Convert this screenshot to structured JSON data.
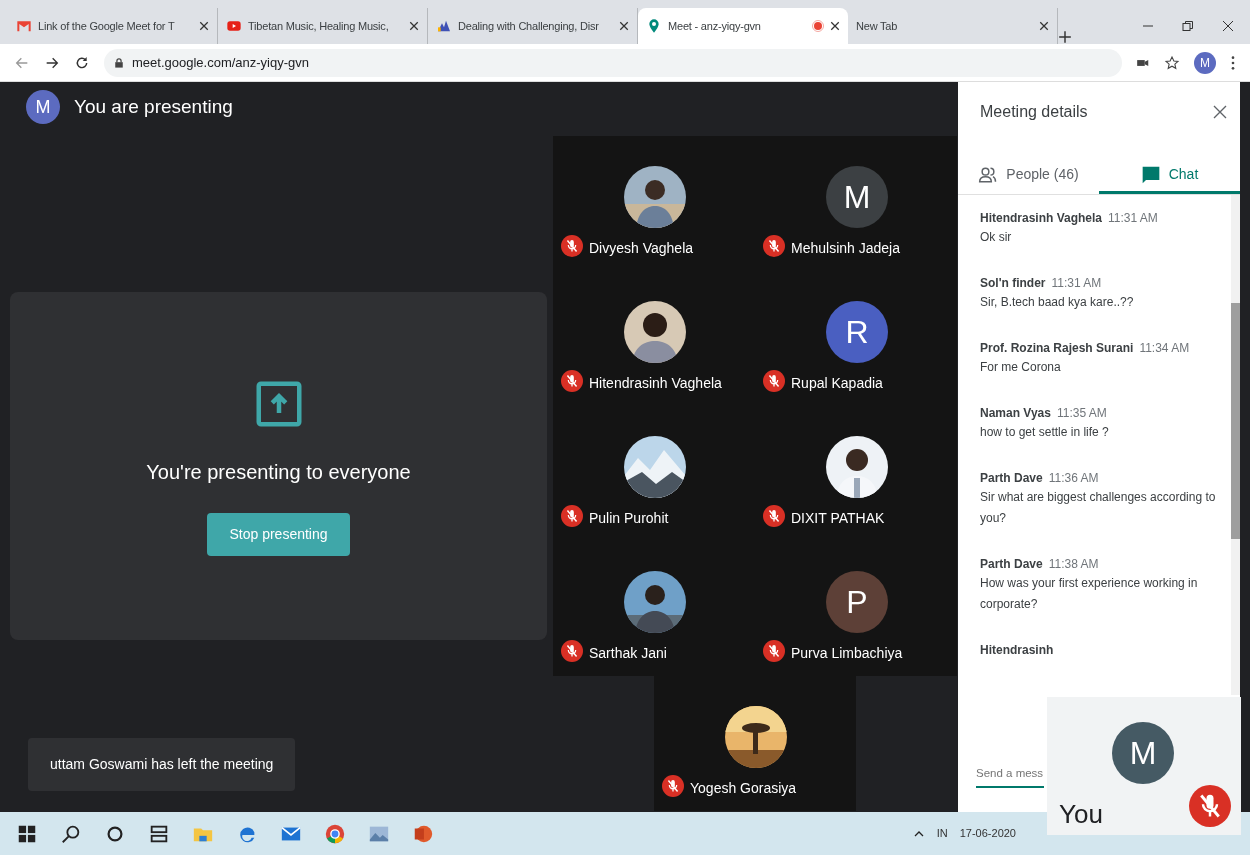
{
  "browser": {
    "tabs": [
      {
        "title": "Link of the Google Meet for T",
        "selected": false,
        "recording": false
      },
      {
        "title": "Tibetan Music, Healing Music,",
        "selected": false,
        "recording": false
      },
      {
        "title": "Dealing with Challenging, Disr",
        "selected": false,
        "recording": false
      },
      {
        "title": "Meet - anz-yiqy-gvn",
        "selected": true,
        "recording": true
      },
      {
        "title": "New Tab",
        "selected": false,
        "recording": false
      }
    ],
    "address": "meet.google.com/anz-yiqy-gvn",
    "profile_initial": "M"
  },
  "stage": {
    "user_initial": "M",
    "banner": "You are presenting",
    "presenting_message": "You're presenting to everyone",
    "stop_button": "Stop presenting",
    "toast": "uttam Goswami has left the meeting"
  },
  "participants": [
    {
      "name": "Divyesh Vaghela",
      "kind": "picture",
      "muted": true
    },
    {
      "name": "Mehulsinh Jadeja",
      "kind": "letter",
      "initial": "M",
      "color": "#3c4043",
      "muted": true
    },
    {
      "name": "Hitendrasinh Vaghela",
      "kind": "picture",
      "muted": true
    },
    {
      "name": "Rupal Kapadia",
      "kind": "letter",
      "initial": "R",
      "color": "#4a5fc1",
      "muted": true
    },
    {
      "name": "Pulin Purohit",
      "kind": "picture",
      "muted": true
    },
    {
      "name": "DIXIT PATHAK",
      "kind": "picture",
      "muted": true
    },
    {
      "name": "Sarthak Jani",
      "kind": "picture",
      "muted": true
    },
    {
      "name": "Purva Limbachiya",
      "kind": "letter",
      "initial": "P",
      "color": "#5d4037",
      "muted": true
    },
    {
      "name": "Yogesh Gorasiya",
      "kind": "picture",
      "muted": true
    }
  ],
  "panel": {
    "title": "Meeting details",
    "tabs": [
      {
        "label": "People (46)",
        "selected": false
      },
      {
        "label": "Chat",
        "selected": true
      }
    ],
    "messages": [
      {
        "sender": "Hitendrasinh Vaghela",
        "time": "11:31 AM",
        "text": "Ok sir"
      },
      {
        "sender": "Sol'n finder",
        "time": "11:31 AM",
        "text": "Sir, B.tech baad kya kare..??"
      },
      {
        "sender": "Prof. Rozina Rajesh Surani",
        "time": "11:34 AM",
        "text": "For me Corona"
      },
      {
        "sender": "Naman Vyas",
        "time": "11:35 AM",
        "text": "how to get settle in life ?"
      },
      {
        "sender": "Parth Dave",
        "time": "11:36 AM",
        "text": "Sir what are biggest challenges according to you?"
      },
      {
        "sender": "Parth Dave",
        "time": "11:38 AM",
        "text": "How was your first experience working in corporate?"
      },
      {
        "sender": "Hitendrasinh"
      }
    ],
    "input_placeholder": "Send a mess"
  },
  "self_view": {
    "initial": "M",
    "label": "You",
    "muted": true
  },
  "taskbar": {
    "language": "IN",
    "date": "17-06-2020"
  }
}
